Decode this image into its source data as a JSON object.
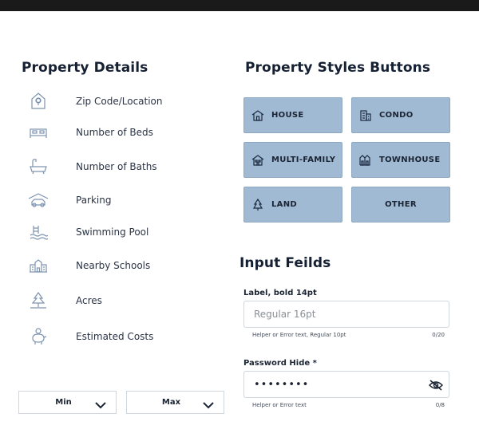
{
  "details": {
    "title": "Property Details",
    "items": [
      {
        "label": "Zip Code/Location",
        "icon": "location-house-icon"
      },
      {
        "label": "Number of Beds",
        "icon": "bed-icon"
      },
      {
        "label": "Number of Baths",
        "icon": "bathtub-icon"
      },
      {
        "label": "Parking",
        "icon": "garage-car-icon"
      },
      {
        "label": "Swimming Pool",
        "icon": "pool-ladder-icon"
      },
      {
        "label": "Nearby Schools",
        "icon": "school-icon"
      },
      {
        "label": "Acres",
        "icon": "tree-icon"
      },
      {
        "label": "Estimated Costs",
        "icon": "piggy-bank-icon"
      }
    ]
  },
  "styles": {
    "title": "Property Styles Buttons",
    "buttons": [
      {
        "label": "HOUSE",
        "icon": "house-icon"
      },
      {
        "label": "CONDO",
        "icon": "condo-building-icon"
      },
      {
        "label": "MULTI-FAMILY",
        "icon": "multi-family-icon"
      },
      {
        "label": "TOWNHOUSE",
        "icon": "townhouse-icon"
      },
      {
        "label": "LAND",
        "icon": "tree-icon"
      },
      {
        "label": "OTHER",
        "icon": ""
      }
    ]
  },
  "inputs": {
    "title": "Input Feilds",
    "field1": {
      "label": "Label, bold 14pt",
      "placeholder": "Regular 16pt",
      "helper": "Helper or Error text, Regular 10pt",
      "counter": "0/20"
    },
    "field2": {
      "label": "Password Hide *",
      "value": "••••••••",
      "helper": "Helper or Error text",
      "counter": "0/8"
    }
  },
  "selects": {
    "min": "Min",
    "max": "Max"
  },
  "colors": {
    "button_bg": "#a1bad4",
    "icon_stroke": "#7d94b1",
    "text_dark": "#152033"
  }
}
